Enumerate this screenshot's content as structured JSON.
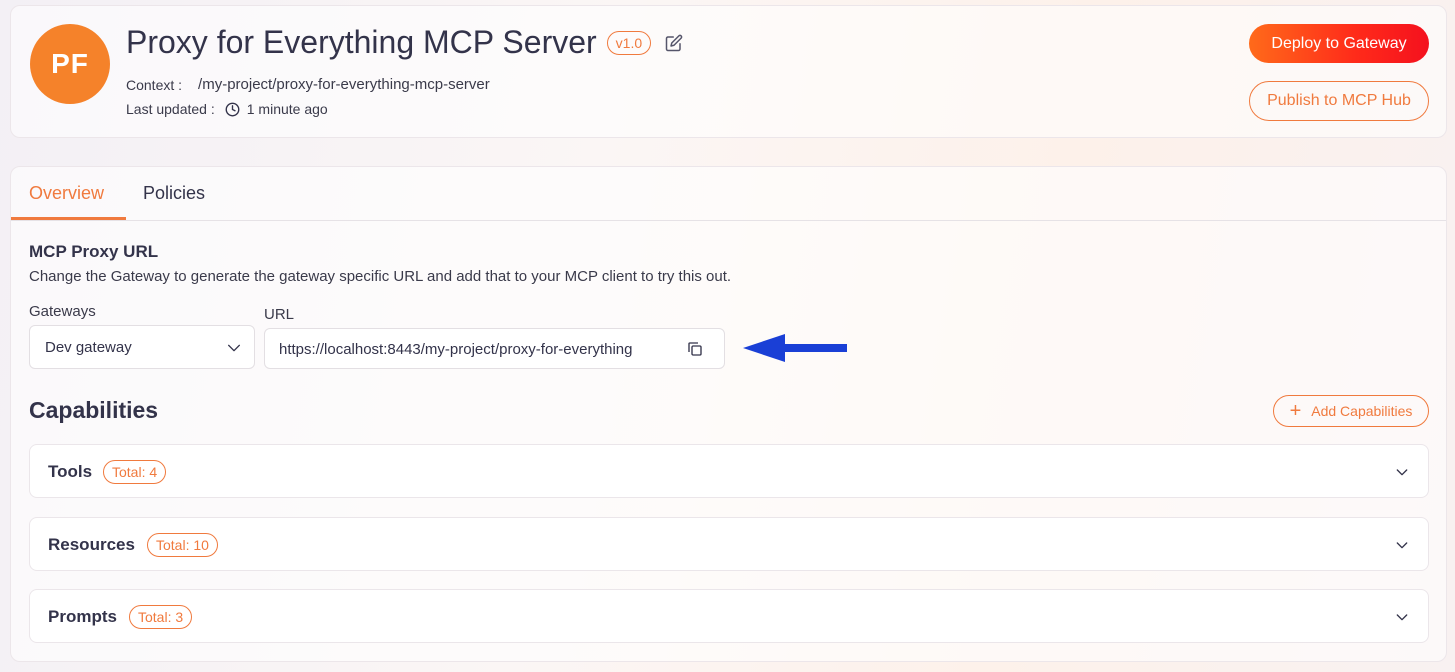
{
  "header": {
    "avatar_initials": "PF",
    "title": "Proxy for Everything MCP Server",
    "version": "v1.0",
    "context_label": "Context :",
    "context_value": "/my-project/proxy-for-everything-mcp-server",
    "updated_label": "Last updated :",
    "updated_value": "1 minute ago",
    "deploy_label": "Deploy to Gateway",
    "publish_label": "Publish to MCP Hub"
  },
  "tabs": [
    {
      "label": "Overview",
      "active": true
    },
    {
      "label": "Policies",
      "active": false
    }
  ],
  "proxy": {
    "title": "MCP Proxy URL",
    "description": "Change the Gateway to generate the gateway specific URL and add that to your MCP client to try this out.",
    "gateways_label": "Gateways",
    "gateway_selected": "Dev gateway",
    "url_label": "URL",
    "url_value": "https://localhost:8443/my-project/proxy-for-everything"
  },
  "capabilities": {
    "title": "Capabilities",
    "add_label": "Add Capabilities",
    "items": [
      {
        "name": "Tools",
        "badge": "Total: 4"
      },
      {
        "name": "Resources",
        "badge": "Total: 10"
      },
      {
        "name": "Prompts",
        "badge": "Total: 3"
      }
    ]
  },
  "colors": {
    "accent": "#f07a3e",
    "avatar": "#f5822a",
    "annotation_arrow": "#1a3fd6"
  },
  "icons": [
    "edit-icon",
    "clock-icon",
    "chevron-down-icon",
    "copy-icon",
    "plus-icon",
    "arrow-annotation-icon"
  ]
}
